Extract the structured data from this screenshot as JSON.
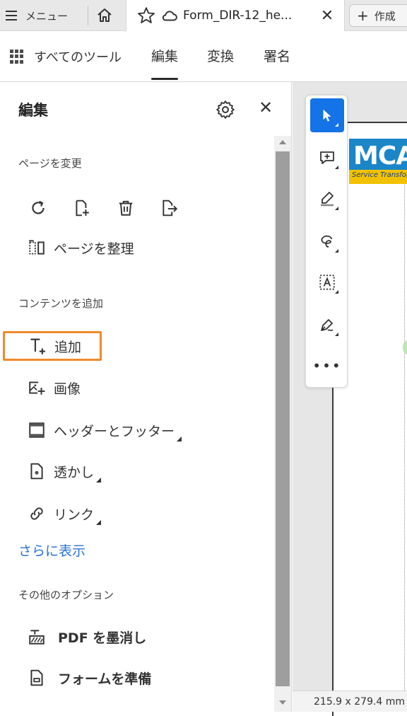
{
  "tabbar": {
    "menu_label": "メニュー",
    "document_title": "Form_DIR-12_he...",
    "create_label": "作成"
  },
  "toolbar": {
    "all_tools": "すべてのツール",
    "tabs": [
      "編集",
      "変換",
      "署名"
    ]
  },
  "panel": {
    "title": "編集",
    "sections": {
      "change_pages": "ページを変更",
      "add_content": "コンテンツを追加",
      "other_options": "その他のオプション"
    },
    "organize_pages": "ページを整理",
    "add_text": "追加",
    "image": "画像",
    "header_footer": "ヘッダーとフッター",
    "watermark": "透かし",
    "link": "リンク",
    "show_more": "さらに表示",
    "redact_pdf": "PDF を墨消し",
    "prepare_form": "フォームを準備"
  },
  "document": {
    "logo_text": "MCA",
    "logo_tagline": "Service Transformation"
  },
  "status": {
    "page_size": "215.9 x 279.4 mm"
  },
  "colors": {
    "accent_blue": "#1473e6",
    "highlight_orange": "#f08a2c",
    "link_blue": "#2b74d6"
  }
}
